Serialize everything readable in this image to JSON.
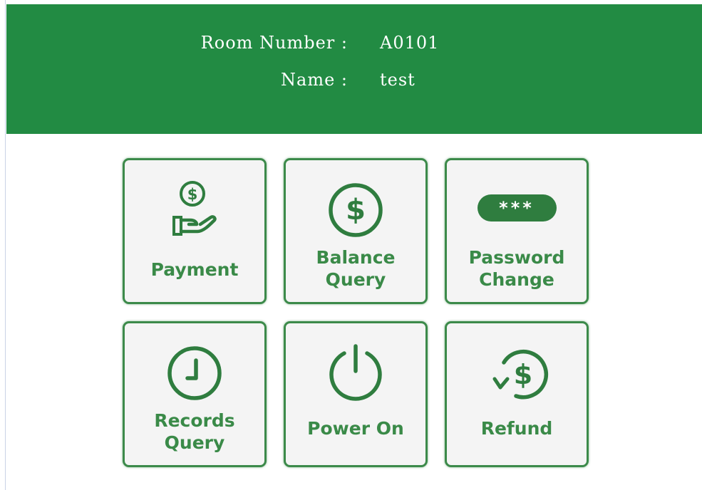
{
  "header": {
    "room_label": "Room Number :",
    "room_value": "A0101",
    "name_label": "Name :",
    "name_value": "test"
  },
  "tiles": [
    {
      "label": "Payment",
      "icon": "hand-coin-icon"
    },
    {
      "label": "Balance\nQuery",
      "icon": "dollar-circle-icon"
    },
    {
      "label": "Password\nChange",
      "icon": "password-mask-icon",
      "mask_text": "***"
    },
    {
      "label": "Records\nQuery",
      "icon": "clock-icon"
    },
    {
      "label": "Power On",
      "icon": "power-icon"
    },
    {
      "label": "Refund",
      "icon": "refund-dollar-icon"
    }
  ],
  "colors": {
    "header_bg": "#228b43",
    "tile_border": "#3c8a4a",
    "tile_bg": "#f4f4f4",
    "accent": "#2f7d3f"
  }
}
